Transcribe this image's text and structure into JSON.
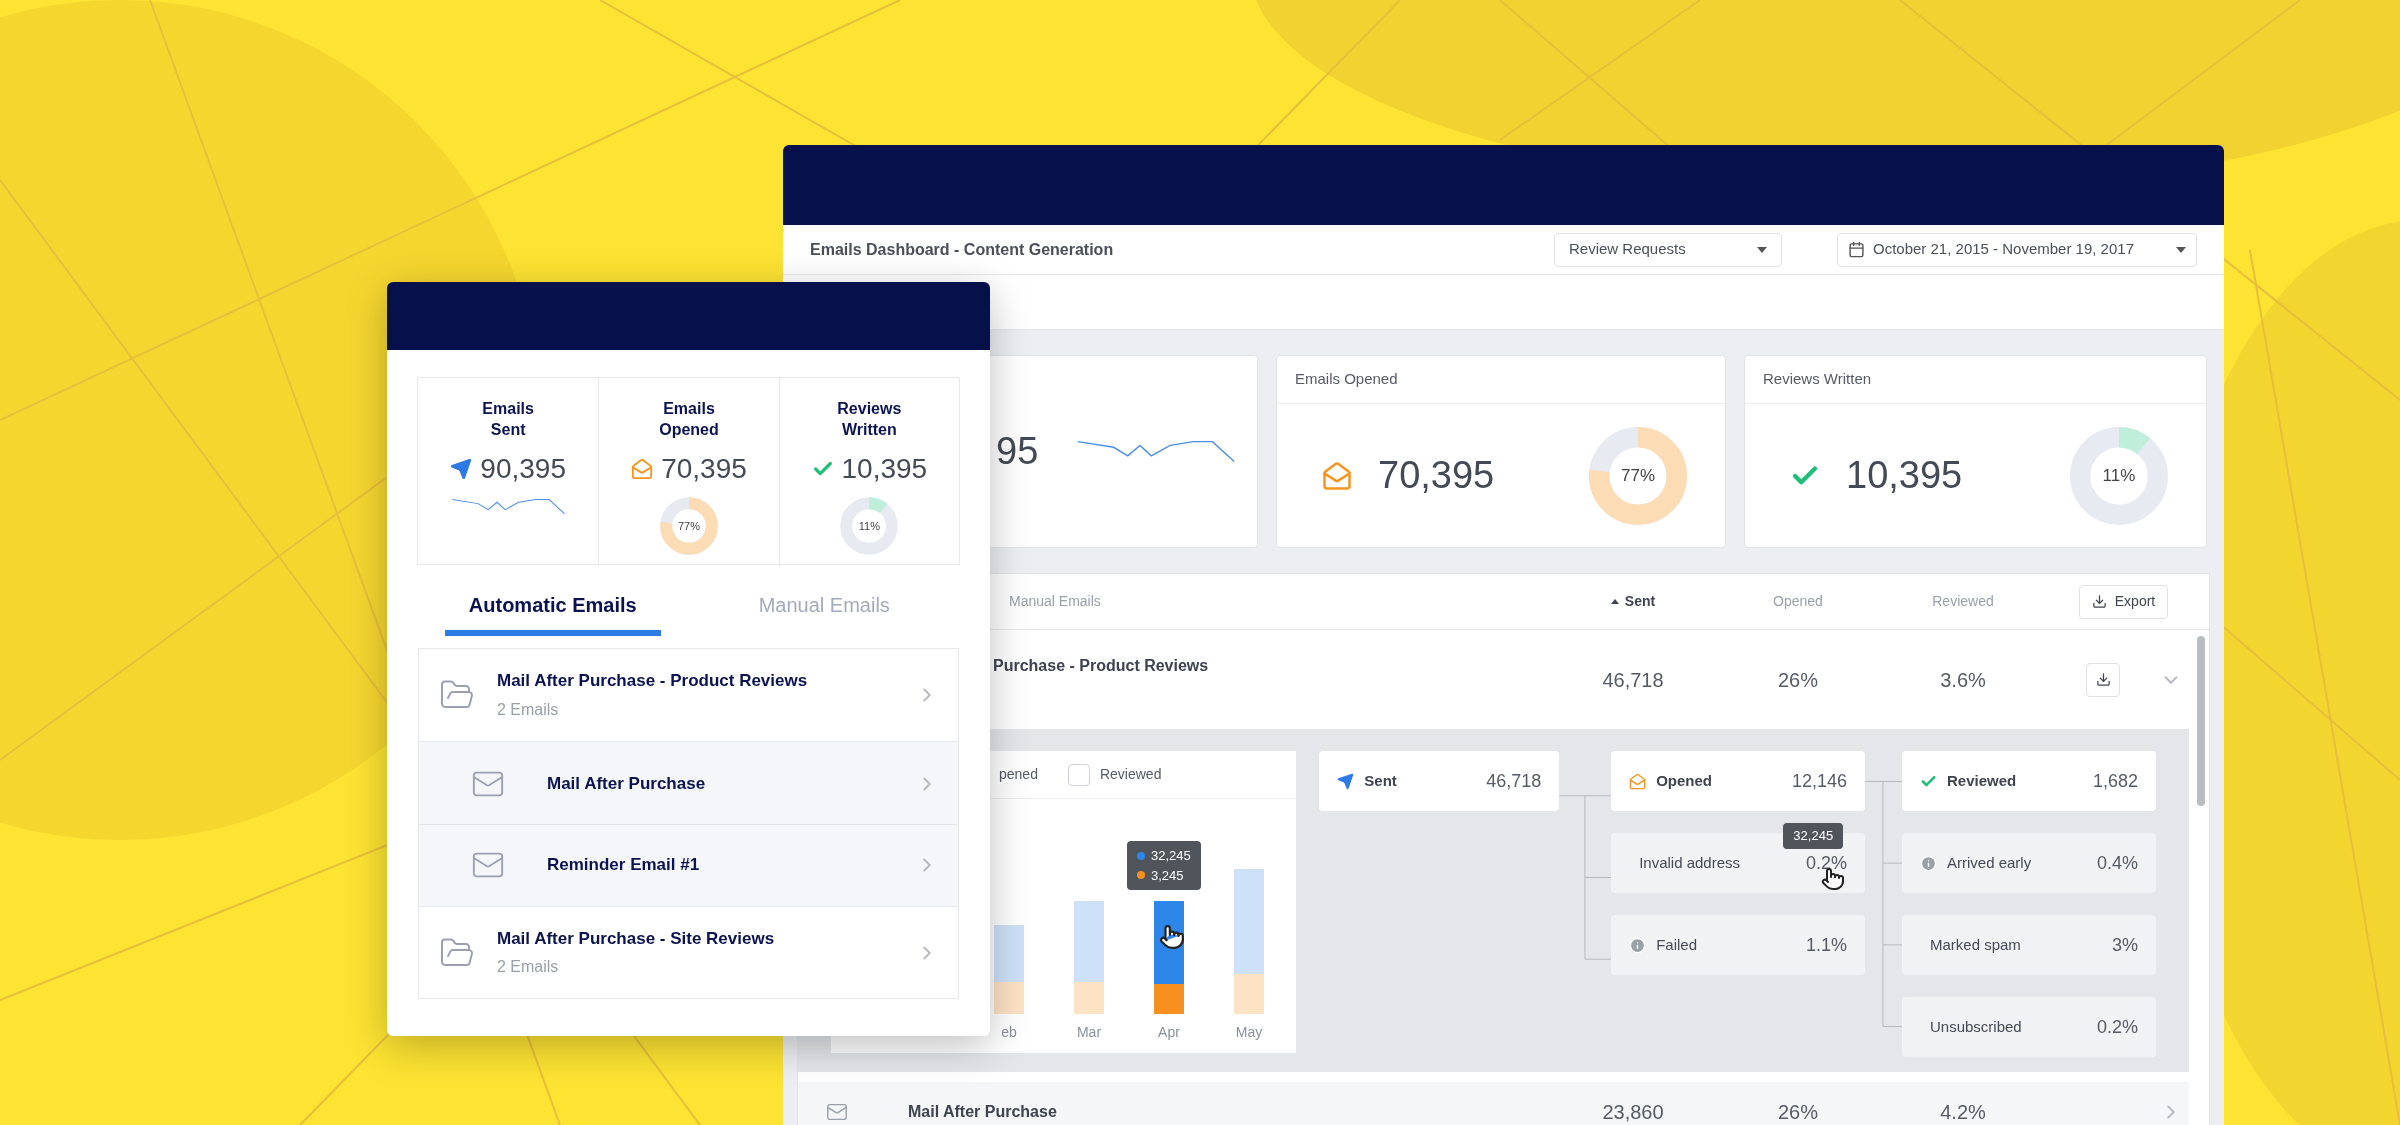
{
  "dashboard": {
    "title": "Emails Dashboard - Content Generation",
    "filter": "Review Requests",
    "date_range": "October 21, 2015 - November 19, 2017",
    "stats": [
      {
        "kind": "sent",
        "value": "95"
      },
      {
        "kind": "opened",
        "label": "Emails Opened",
        "value": "70,395",
        "percent": "77%",
        "level": 0.77
      },
      {
        "kind": "reviewed",
        "label": "Reviews Written",
        "value": "10,395",
        "percent": "11%",
        "level": 0.11
      }
    ],
    "table": {
      "columns": [
        {
          "label": "Manual Emails",
          "sorted": false
        },
        {
          "label": "Sent",
          "sorted": true
        },
        {
          "label": "Opened",
          "sorted": false
        },
        {
          "label": "Reviewed",
          "sorted": false
        }
      ],
      "export": "Export",
      "rows": [
        {
          "name": "Purchase - Product Reviews",
          "sent": "46,718",
          "opened": "26%",
          "reviewed": "3.6%",
          "expanded": true
        },
        {
          "name": "Mail After Purchase",
          "sent": "23,860",
          "opened": "26%",
          "reviewed": "4.2%",
          "expanded": false
        }
      ]
    },
    "detail": {
      "legend_fragment": "pened",
      "legend_checkbox": {
        "label": "Reviewed",
        "checked": false
      },
      "bars": [
        {
          "label": "eb",
          "selected": false
        },
        {
          "label": "Mar",
          "selected": false
        },
        {
          "label": "Apr",
          "selected": true
        },
        {
          "label": "May",
          "selected": false
        }
      ],
      "bar_tooltip": [
        {
          "value": "32,245",
          "color": "#2d87e8"
        },
        {
          "value": "3,245",
          "color": "#f7901e"
        }
      ],
      "sent": {
        "label": "Sent",
        "value": "46,718"
      },
      "opened": [
        {
          "kind": "opened",
          "label": "Opened",
          "value": "12,146"
        },
        {
          "kind": "plain",
          "label": "Invalid address",
          "value": "0.2%",
          "tooltip": "32,245"
        },
        {
          "kind": "info",
          "label": "Failed",
          "value": "1.1%"
        }
      ],
      "reviewed": [
        {
          "kind": "reviewed",
          "label": "Reviewed",
          "value": "1,682"
        },
        {
          "kind": "info",
          "label": "Arrived early",
          "value": "0.4%"
        },
        {
          "kind": "plain",
          "label": "Marked spam",
          "value": "3%"
        },
        {
          "kind": "plain",
          "label": "Unsubscribed",
          "value": "0.2%"
        }
      ]
    }
  },
  "card": {
    "stats": [
      {
        "kind": "sent",
        "label": "Emails Sent",
        "value": "90,395"
      },
      {
        "kind": "opened",
        "label": "Emails Opened",
        "value": "70,395",
        "percent": "77%",
        "level": 0.77
      },
      {
        "kind": "reviewed",
        "label": "Reviews Written",
        "value": "10,395",
        "percent": "11%",
        "level": 0.11
      }
    ],
    "tabs": [
      {
        "label": "Automatic Emails",
        "selected": true
      },
      {
        "label": "Manual Emails",
        "selected": false
      }
    ],
    "list": [
      {
        "kind": "folder",
        "title": "Mail After Purchase - Product Reviews",
        "subtitle": "2 Emails",
        "children": [
          {
            "kind": "email",
            "title": "Mail After Purchase"
          },
          {
            "kind": "email",
            "title": "Reminder Email #1"
          }
        ]
      },
      {
        "kind": "folder",
        "title": "Mail After Purchase - Site Reviews",
        "subtitle": "2 Emails"
      }
    ]
  }
}
